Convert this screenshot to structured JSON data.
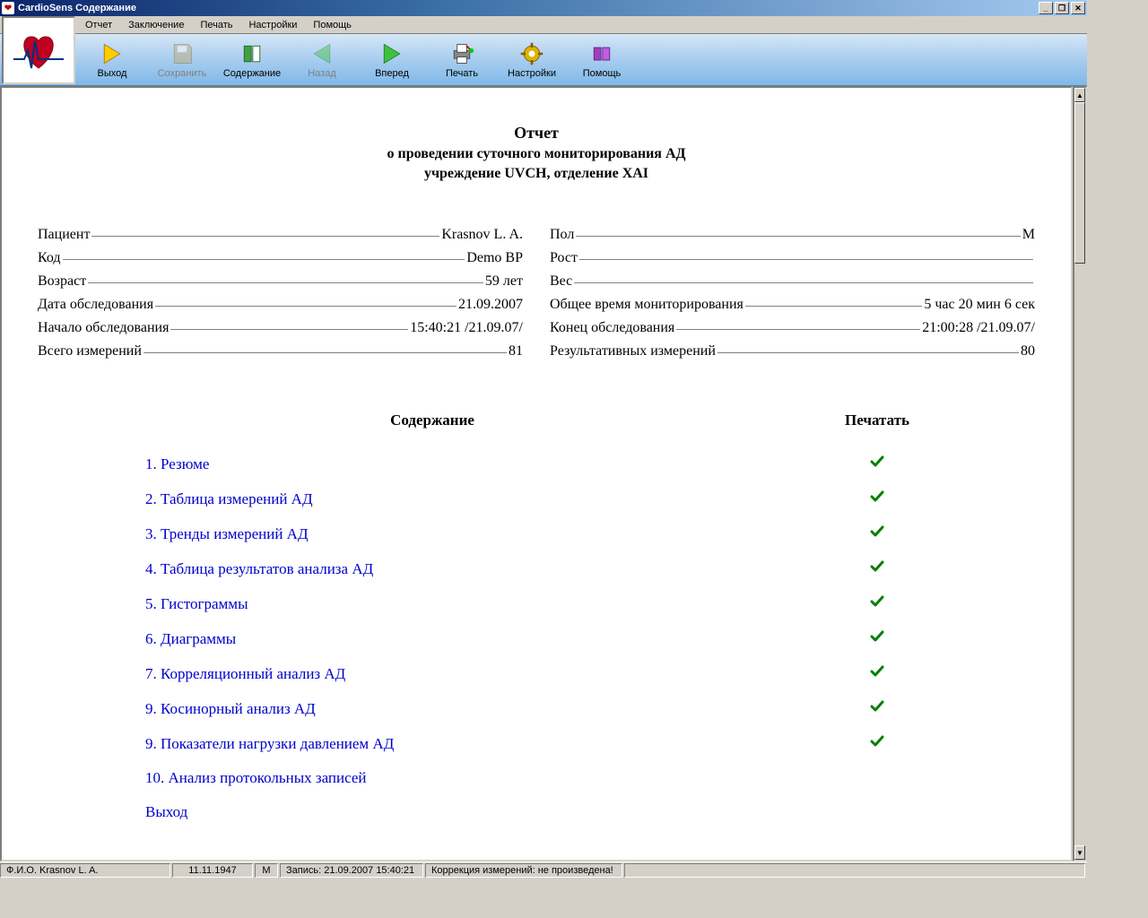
{
  "app_title": "CardioSens   Содержание",
  "menu": [
    "Отчет",
    "Заключение",
    "Печать",
    "Настройки",
    "Помощь"
  ],
  "toolbar": [
    {
      "label": "Выход",
      "icon": "exit",
      "enabled": true
    },
    {
      "label": "Сохранить",
      "icon": "save",
      "enabled": false
    },
    {
      "label": "Содержание",
      "icon": "contents",
      "enabled": true
    },
    {
      "label": "Назад",
      "icon": "back",
      "enabled": false
    },
    {
      "label": "Вперед",
      "icon": "forward",
      "enabled": true
    },
    {
      "label": "Печать",
      "icon": "print",
      "enabled": true
    },
    {
      "label": "Настройки",
      "icon": "settings",
      "enabled": true
    },
    {
      "label": "Помощь",
      "icon": "help",
      "enabled": true
    }
  ],
  "report": {
    "title": "Отчет",
    "subtitle1": "о проведении суточного мониторирования АД",
    "subtitle2": "учреждение UVCH, отделение XAI",
    "left": [
      {
        "label": "Пациент",
        "value": "Krasnov L. A."
      },
      {
        "label": "Код",
        "value": "Demo BP"
      },
      {
        "label": "Возраст",
        "value": "59 лет"
      },
      {
        "label": "Дата обследования",
        "value": "21.09.2007"
      },
      {
        "label": "Начало обследования",
        "value": "15:40:21 /21.09.07/"
      },
      {
        "label": "Всего измерений",
        "value": "81"
      }
    ],
    "right": [
      {
        "label": "Пол",
        "value": "М"
      },
      {
        "label": "Рост",
        "value": ""
      },
      {
        "label": "Вес",
        "value": ""
      },
      {
        "label": "Общее время мониторирования",
        "value": "5 час 20 мин 6 сек"
      },
      {
        "label": "Конец обследования",
        "value": "21:00:28 /21.09.07/"
      },
      {
        "label": "Результативных измерений",
        "value": "80"
      }
    ],
    "toc_title": "Содержание",
    "print_title": "Печатать",
    "toc": [
      {
        "text": "1. Резюме",
        "checked": true
      },
      {
        "text": "2. Таблица измерений АД",
        "checked": true
      },
      {
        "text": "3. Тренды измерений АД",
        "checked": true
      },
      {
        "text": "4. Таблица результатов анализа АД",
        "checked": true
      },
      {
        "text": "5. Гистограммы",
        "checked": true
      },
      {
        "text": "6. Диаграммы",
        "checked": true
      },
      {
        "text": "7. Корреляционный анализ АД",
        "checked": true
      },
      {
        "text": "9. Косинорный анализ АД",
        "checked": true
      },
      {
        "text": "9. Показатели нагрузки давлением АД",
        "checked": true
      },
      {
        "text": "10. Анализ протокольных записей",
        "checked": false
      },
      {
        "text": "Выход",
        "checked": false
      }
    ]
  },
  "status": {
    "fio": "Ф.И.О. Krasnov  L. A.",
    "dob": "11.11.1947",
    "sex": "М",
    "rec": "Запись: 21.09.2007 15:40:21",
    "corr": "Коррекция измерений: не произведена!"
  }
}
